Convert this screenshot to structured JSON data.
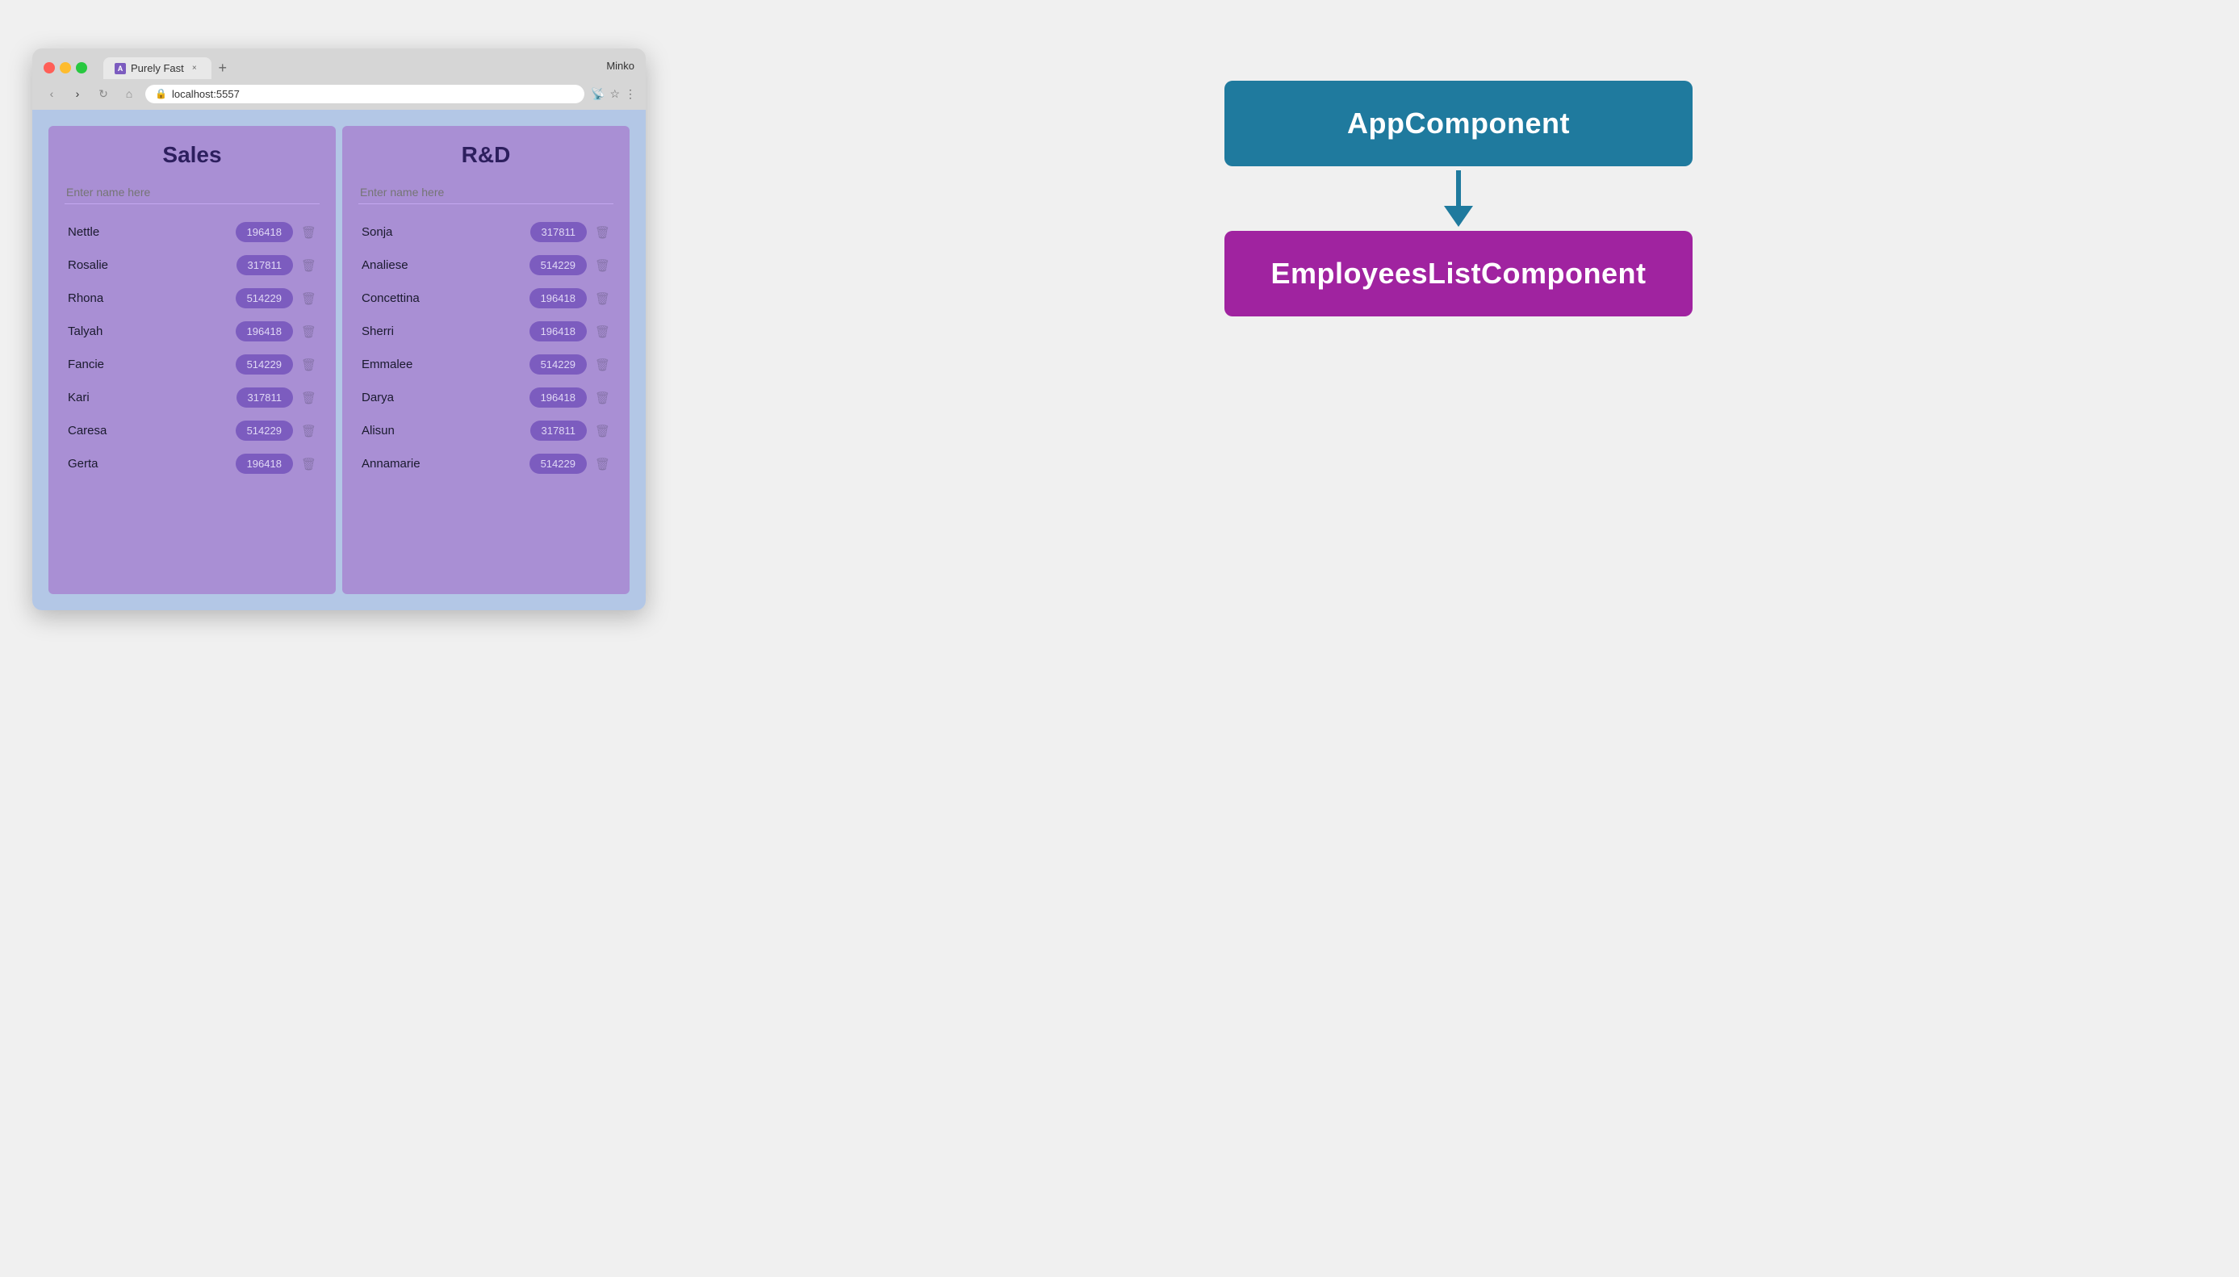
{
  "browser": {
    "traffic_lights": [
      "red",
      "yellow",
      "green"
    ],
    "tab_label": "Purely Fast",
    "tab_favicon": "A",
    "tab_close": "×",
    "new_tab_icon": "+",
    "user_label": "Minko",
    "nav_back": "‹",
    "nav_forward": "›",
    "nav_refresh": "↻",
    "nav_home": "⌂",
    "address_icon": "🔒",
    "address_url": "localhost:5557",
    "toolbar_cast": "📡",
    "toolbar_star": "☆",
    "toolbar_menu": "⋮"
  },
  "app": {
    "outer_bg": "#b3c7e6",
    "departments": [
      {
        "id": "sales",
        "title": "Sales",
        "input_placeholder": "Enter name here",
        "employees": [
          {
            "name": "Nettle",
            "salary": "196418"
          },
          {
            "name": "Rosalie",
            "salary": "317811"
          },
          {
            "name": "Rhona",
            "salary": "514229"
          },
          {
            "name": "Talyah",
            "salary": "196418"
          },
          {
            "name": "Fancie",
            "salary": "514229"
          },
          {
            "name": "Kari",
            "salary": "317811"
          },
          {
            "name": "Caresa",
            "salary": "514229"
          },
          {
            "name": "Gerta",
            "salary": "196418"
          }
        ]
      },
      {
        "id": "rd",
        "title": "R&D",
        "input_placeholder": "Enter name here",
        "employees": [
          {
            "name": "Sonja",
            "salary": "317811"
          },
          {
            "name": "Analiese",
            "salary": "514229"
          },
          {
            "name": "Concettina",
            "salary": "196418"
          },
          {
            "name": "Sherri",
            "salary": "196418"
          },
          {
            "name": "Emmalee",
            "salary": "514229"
          },
          {
            "name": "Darya",
            "salary": "196418"
          },
          {
            "name": "Alisun",
            "salary": "317811"
          },
          {
            "name": "Annamarie",
            "salary": "514229"
          }
        ]
      }
    ]
  },
  "diagram": {
    "app_component_label": "AppComponent",
    "employees_component_label": "EmployeesListComponent",
    "arrow_color": "#1f7a9e"
  }
}
